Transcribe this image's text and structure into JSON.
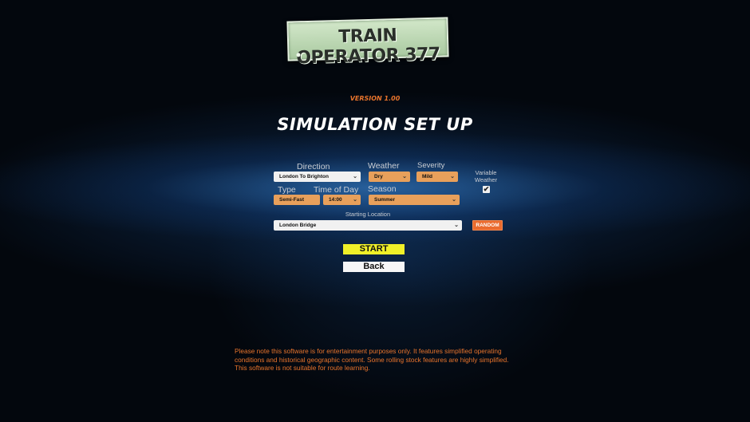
{
  "logo": {
    "text": "TRAIN OPERATOR 377"
  },
  "version": "VERSION 1.00",
  "title": "SIMULATION SET UP",
  "form": {
    "direction": {
      "label": "Direction",
      "value": "London To Brighton"
    },
    "weather": {
      "label": "Weather",
      "value": "Dry"
    },
    "severity": {
      "label": "Severity",
      "value": "Mild"
    },
    "variable_weather": {
      "label_line1": "Variable",
      "label_line2": "Weather",
      "checked": true,
      "check_glyph": "✔"
    },
    "type": {
      "label": "Type",
      "value": "Semi-Fast"
    },
    "time_of_day": {
      "label": "Time of Day",
      "value": "14:00"
    },
    "season": {
      "label": "Season",
      "value": "Summer"
    },
    "starting_location": {
      "label": "Starting Location",
      "value": "London Bridge"
    },
    "random_label": "RANDOM"
  },
  "buttons": {
    "start": "START",
    "back": "Back"
  },
  "disclaimer": {
    "line1": "Please note this software is for entertainment purposes only.  It features simplified operating",
    "line2": "conditions and historical geographic content.  Some rolling stock features are highly simplified.",
    "line3": "This software is not suitable for route learning."
  },
  "icons": {
    "dropdown": "chevron-down-icon",
    "checkbox": "checkmark-icon"
  },
  "colors": {
    "accent_orange": "#e8742c",
    "start_yellow": "#f0f028",
    "dropdown_orange": "#e8a05b",
    "random_orange": "#ea6b2e"
  }
}
